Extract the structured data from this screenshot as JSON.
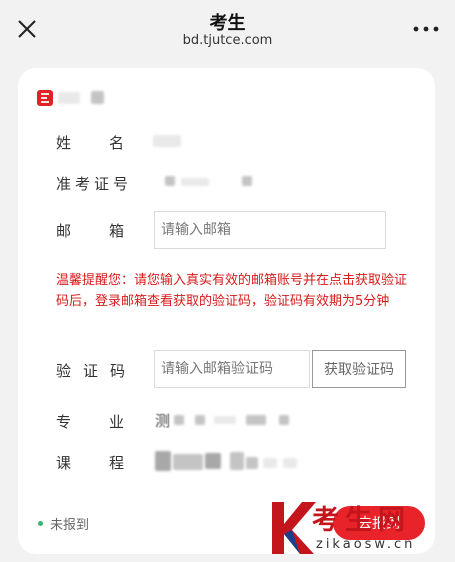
{
  "header": {
    "title": "考生",
    "url": "bd.tjutce.com"
  },
  "form": {
    "name_label": "姓名",
    "exam_id_label": "准考证号",
    "email_label": "邮箱",
    "email_placeholder": "请输入邮箱",
    "notice": "温馨提醒您：请您输入真实有效的邮箱账号并在点击获取验证码后，登录邮箱查看获取的验证码，验证码有效期为5分钟",
    "code_label": "验证码",
    "code_placeholder": "请输入邮箱验证码",
    "get_code_button": "获取验证码",
    "major_label": "专业",
    "major_value_visible": "测",
    "course_label": "课程"
  },
  "footer": {
    "status": "未报到",
    "primary_button": "去报到"
  },
  "watermark": {
    "brand": "考生网",
    "domain": "zikaosw.cn"
  },
  "colors": {
    "accent_red": "#e8232a",
    "notice_red": "#d71a1a",
    "status_green": "#3cb371",
    "page_bg": "#f2f2f2"
  },
  "icons": {
    "close": "close-icon",
    "more": "more-dots-icon",
    "brand": "app-logo-icon"
  }
}
